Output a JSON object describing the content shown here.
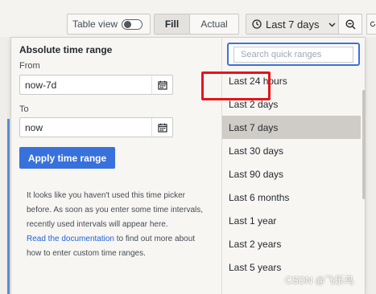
{
  "toolbar": {
    "table_view_label": "Table view",
    "fill_label": "Fill",
    "actual_label": "Actual",
    "time_range_label": "Last 7 days"
  },
  "absolute": {
    "title": "Absolute time range",
    "from_label": "From",
    "from_value": "now-7d",
    "to_label": "To",
    "to_value": "now",
    "apply_label": "Apply time range",
    "help_text": "It looks like you haven't used this time picker before. As soon as you enter some time intervals, recently used intervals will appear here.",
    "help_link": "Read the documentation",
    "help_tail": " to find out more about how to enter custom time ranges."
  },
  "quick": {
    "search_placeholder": "Search quick ranges",
    "items": [
      {
        "label": "Last 24 hours"
      },
      {
        "label": "Last 2 days"
      },
      {
        "label": "Last 7 days"
      },
      {
        "label": "Last 30 days"
      },
      {
        "label": "Last 90 days"
      },
      {
        "label": "Last 6 months"
      },
      {
        "label": "Last 1 year"
      },
      {
        "label": "Last 2 years"
      },
      {
        "label": "Last 5 years"
      }
    ],
    "selected_index": 2
  },
  "watermark": "CSDN @飞乐鸟",
  "colors": {
    "accent": "#3871dc",
    "link": "#1f62e0",
    "highlight": "#e5141a",
    "selected_row": "#cfccc7"
  },
  "icons": [
    "clock-icon",
    "chevron-down-icon",
    "zoom-out-icon",
    "calendar-icon",
    "search-icon"
  ]
}
